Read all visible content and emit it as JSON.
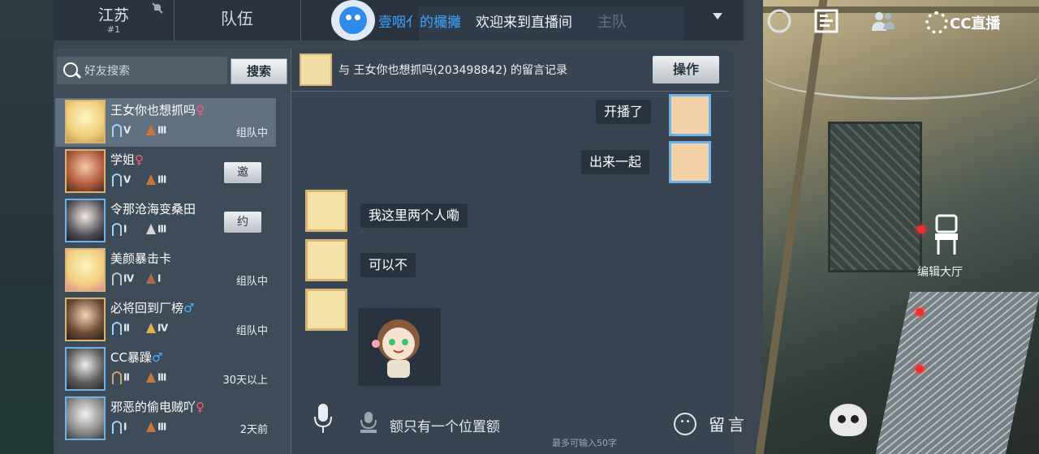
{
  "header": {
    "region_title": "江苏",
    "region_rank": "#1",
    "tab_team": "队伍",
    "ghost_text": "主队",
    "stream_name": "壹咽亻的欘攡",
    "welcome": "欢迎来到直播间",
    "cc_logo_text": "CC直播"
  },
  "friends_panel": {
    "search_placeholder": "好友搜索",
    "search_button": "搜索",
    "friends": [
      {
        "name": "王女你也想抓吗",
        "gender": "♀",
        "rank1": "Ⅴ",
        "rank2": "Ⅲ",
        "status": "组队中",
        "action": ""
      },
      {
        "name": "学姐",
        "gender": "♀",
        "rank1": "Ⅴ",
        "rank2": "Ⅲ",
        "status": "",
        "action": "邀"
      },
      {
        "name": "令那沧海变桑田",
        "gender": "",
        "rank1": "Ⅰ",
        "rank2": "Ⅲ",
        "status": "",
        "action": "约"
      },
      {
        "name": "美颜暴击卡",
        "gender": "",
        "rank1": "Ⅳ",
        "rank2": "Ⅰ",
        "status": "组队中",
        "action": ""
      },
      {
        "name": "必将回到厂榜",
        "gender": "♂",
        "rank1": "Ⅱ",
        "rank2": "Ⅳ",
        "status": "组队中",
        "action": ""
      },
      {
        "name": "CC暴躁",
        "gender": "♂",
        "rank1": "Ⅱ",
        "rank2": "Ⅲ",
        "status": "30天以上",
        "action": ""
      },
      {
        "name": "邪恶的偷电贼吖",
        "gender": "♀",
        "rank1": "Ⅰ",
        "rank2": "Ⅲ",
        "status": "2天前",
        "action": ""
      }
    ]
  },
  "chat": {
    "title": "与 王女你也想抓吗(203498842) 的留言记录",
    "operate_button": "操作",
    "messages": [
      {
        "side": "right",
        "text": "开播了"
      },
      {
        "side": "right",
        "text": "出来一起"
      },
      {
        "side": "left",
        "text": "我这里两个人嘞"
      },
      {
        "side": "left",
        "text": "可以不"
      },
      {
        "side": "left",
        "text": ""
      }
    ],
    "input_value": "额只有一个位置额",
    "limit_text": "最多可输入50字",
    "leave_message": "留言"
  },
  "scene": {
    "edit_hall": "编辑大厅"
  },
  "colors": {
    "accent_blue": "#3aa4ff",
    "female": "#ff5b7a",
    "male": "#4ab0ff"
  }
}
